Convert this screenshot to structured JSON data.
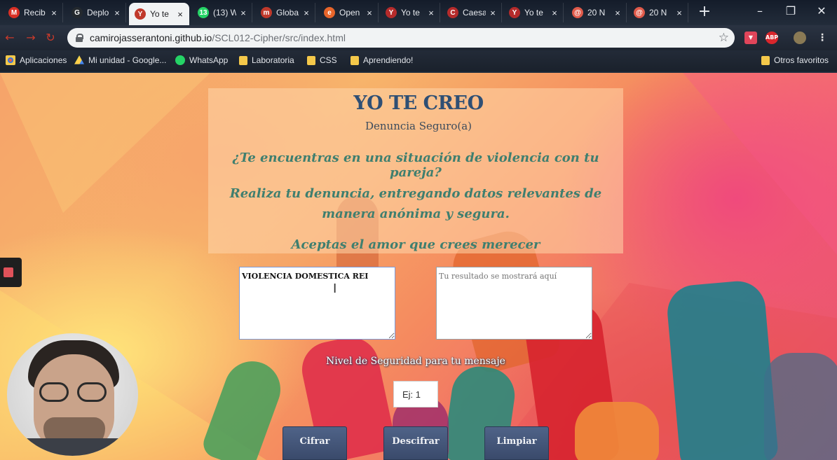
{
  "browser": {
    "tabs": [
      {
        "label": "Recib",
        "icon": "gmail-icon",
        "color": "#d93025",
        "glyph": "M",
        "active": false
      },
      {
        "label": "Deplo",
        "icon": "github-icon",
        "color": "#24292e",
        "glyph": "G",
        "active": false
      },
      {
        "label": "Yo te",
        "icon": "yo-te-creo-icon",
        "color": "#c0392b",
        "glyph": "Y",
        "active": true
      },
      {
        "label": "(13) W",
        "icon": "whatsapp-icon",
        "color": "#25d366",
        "glyph": "13",
        "active": false
      },
      {
        "label": "Globa",
        "icon": "m-logo-icon",
        "color": "#c0392b",
        "glyph": "m",
        "active": false
      },
      {
        "label": "Open",
        "icon": "open-e-icon",
        "color": "#e8652a",
        "glyph": "e",
        "active": false
      },
      {
        "label": "Yo te",
        "icon": "yo-te-creo-icon",
        "color": "#b52b2b",
        "glyph": "Y",
        "active": false
      },
      {
        "label": "Caesa",
        "icon": "caesar-icon",
        "color": "#b52b2b",
        "glyph": "C",
        "active": false
      },
      {
        "label": "Yo te",
        "icon": "yo-te-creo-icon",
        "color": "#b52b2b",
        "glyph": "Y",
        "active": false
      },
      {
        "label": "20 N",
        "icon": "spiral-icon",
        "color": "#e05a4a",
        "glyph": "@",
        "active": false
      },
      {
        "label": "20 N",
        "icon": "spiral-icon",
        "color": "#e05a4a",
        "glyph": "@",
        "active": false
      }
    ],
    "url_host": "camirojasserantoni.github.io",
    "url_path": "/SCL012-Cipher/src/index.html",
    "bookmarks": [
      {
        "label": "Aplicaciones",
        "icon": "apps-grid-icon"
      },
      {
        "label": "Mi unidad - Google...",
        "icon": "google-drive-icon"
      },
      {
        "label": "WhatsApp",
        "icon": "whatsapp-icon"
      },
      {
        "label": "Laboratoria",
        "icon": "folder-icon"
      },
      {
        "label": "CSS",
        "icon": "folder-icon"
      },
      {
        "label": "Aprendiendo!",
        "icon": "folder-icon"
      }
    ],
    "other_bookmarks": "Otros favoritos",
    "extensions": [
      "pocket-icon",
      "adblock-icon",
      "profile-avatar"
    ]
  },
  "page": {
    "title": "YO TE CREO",
    "subtitle": "Denuncia Seguro(a)",
    "question": "¿Te encuentras en una situación de violencia con tu pareja?",
    "call_to_action": "Realiza tu denuncia, entregando datos relevantes de manera anónima y segura.",
    "tagline": "Aceptas el amor que crees merecer",
    "input_text": "VIOLENCIA DOMESTICA REI",
    "output_placeholder": "Tu resultado se mostrará aquí",
    "security_label": "Nivel de Seguridad para tu mensaje",
    "offset_placeholder": "Ej: 1",
    "buttons": {
      "encrypt": "Cifrar",
      "decrypt": "Descifrar",
      "clear": "Limpiar"
    }
  },
  "colors": {
    "title": "#2f4f74",
    "teal_text": "#3f7f6f",
    "button": "#3f5073"
  }
}
